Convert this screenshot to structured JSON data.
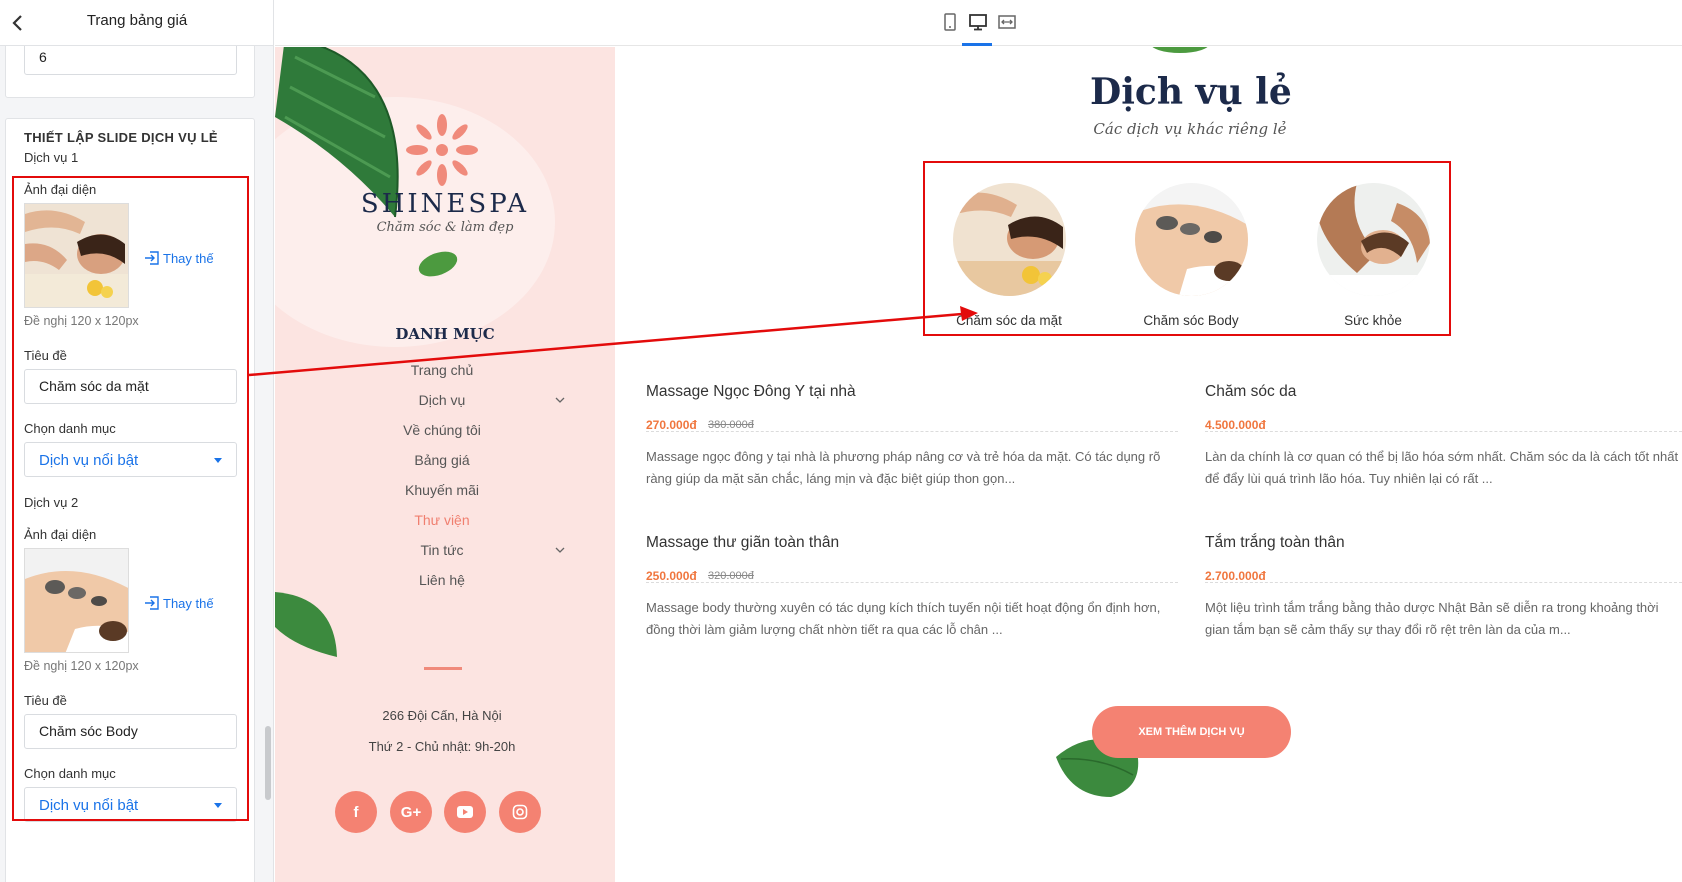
{
  "panel": {
    "title": "Trang bảng giá",
    "top_input_value": "6",
    "section_title": "THIẾT LẬP SLIDE DỊCH VỤ LẺ",
    "replace_label": "Thay thế",
    "services": [
      {
        "heading": "Dịch vụ 1",
        "image_label": "Ảnh đại diện",
        "size_hint": "Đề nghị 120 x 120px",
        "title_label": "Tiêu đề",
        "title_value": "Chăm sóc da mặt",
        "category_label": "Chọn danh mục",
        "category_value": "Dịch vụ nổi bật"
      },
      {
        "heading": "Dịch vụ 2",
        "image_label": "Ảnh đại diện",
        "size_hint": "Đề nghị 120 x 120px",
        "title_label": "Tiêu đề",
        "title_value": "Chăm sóc Body",
        "category_label": "Chọn danh mục",
        "category_value": "Dịch vụ nổi bật"
      }
    ]
  },
  "toolbar": {
    "devices": [
      "mobile-icon",
      "desktop-icon",
      "fullwidth-icon"
    ],
    "active_device": "desktop-icon"
  },
  "site": {
    "brand": "SHINESPA",
    "tagline": "Chăm sóc & làm đẹp",
    "menu_heading": "DANH MỤC",
    "menu": [
      {
        "label": "Trang chủ",
        "has_children": false,
        "active": false
      },
      {
        "label": "Dịch vụ",
        "has_children": true,
        "active": false
      },
      {
        "label": "Về chúng tôi",
        "has_children": false,
        "active": false
      },
      {
        "label": "Bảng giá",
        "has_children": false,
        "active": false
      },
      {
        "label": "Khuyến mãi",
        "has_children": false,
        "active": false
      },
      {
        "label": "Thư viện",
        "has_children": false,
        "active": true
      },
      {
        "label": "Tin tức",
        "has_children": true,
        "active": false
      },
      {
        "label": "Liên hệ",
        "has_children": false,
        "active": false
      }
    ],
    "address": "266 Đội Cấn, Hà Nội",
    "hours": "Thứ 2 - Chủ nhật: 9h-20h",
    "social": [
      "facebook-icon",
      "google-plus-icon",
      "youtube-icon",
      "instagram-icon"
    ],
    "accent_color": "#f48272"
  },
  "main": {
    "title": "Dịch vụ lẻ",
    "subtitle": "Các dịch vụ khác riêng lẻ",
    "services": [
      "Chăm sóc da mặt",
      "Chăm sóc Body",
      "Sức khỏe"
    ],
    "articles": [
      {
        "title": "Massage Ngọc Đông Y tại nhà",
        "price": "270.000đ",
        "old_price": "380.000đ",
        "desc": "Massage ngọc đông y tại nhà là phương pháp nâng cơ và trẻ hóa da mặt. Có tác dụng rõ ràng giúp da mặt săn chắc, láng mịn và đặc biệt giúp thon gọn..."
      },
      {
        "title": "Chăm sóc da",
        "price": "4.500.000đ",
        "old_price": "",
        "desc": "Làn da chính là cơ quan có thể bị lão hóa sớm nhất. Chăm sóc da là cách tốt nhất để đẩy lùi quá trình lão hóa. Tuy nhiên lại có rất ..."
      },
      {
        "title": "Massage thư giãn toàn thân",
        "price": "250.000đ",
        "old_price": "320.000đ",
        "desc": "Massage body thường xuyên có tác dụng kích thích tuyến nội tiết hoạt động ổn định hơn, đồng thời làm giảm lượng chất nhờn tiết ra qua các lỗ chân ..."
      },
      {
        "title": "Tắm trắng toàn thân",
        "price": "2.700.000đ",
        "old_price": "",
        "desc": "Một liệu trình tắm trắng bằng thảo dược Nhật Bản sẽ diễn ra trong khoảng thời gian tắm bạn sẽ cảm thấy sự thay đổi rõ rệt trên làn da của m..."
      }
    ],
    "more_button": "XEM THÊM DỊCH VỤ"
  }
}
